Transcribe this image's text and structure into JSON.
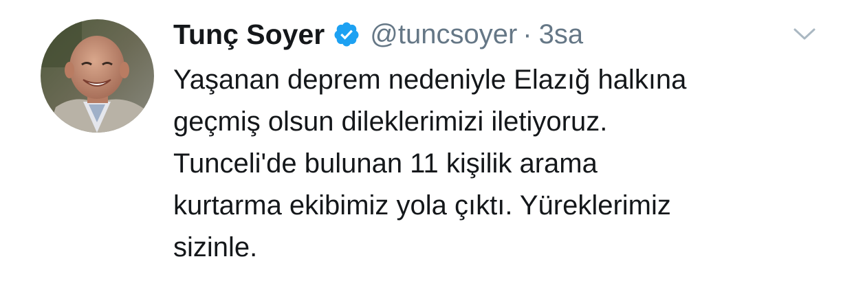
{
  "tweet": {
    "author": {
      "name": "Tunç Soyer",
      "handle": "@tuncsoyer",
      "verified": true
    },
    "separator": "·",
    "time": "3sa",
    "text_lines": [
      "Yaşanan deprem nedeniyle Elazığ halkına",
      "geçmiş olsun dileklerimizi iletiyoruz.",
      "Tunceli'de bulunan 11 kişilik arama",
      "kurtarma ekibimiz yola çıktı. Yüreklerimiz",
      "sizinle."
    ]
  },
  "icons": {
    "verified": "verified-badge-icon",
    "menu": "chevron-down-icon",
    "avatar": "profile-photo"
  },
  "colors": {
    "text_primary": "#14171a",
    "text_secondary": "#657786",
    "verified_blue": "#1da1f2",
    "chevron": "#aab8c2",
    "background": "#ffffff"
  }
}
